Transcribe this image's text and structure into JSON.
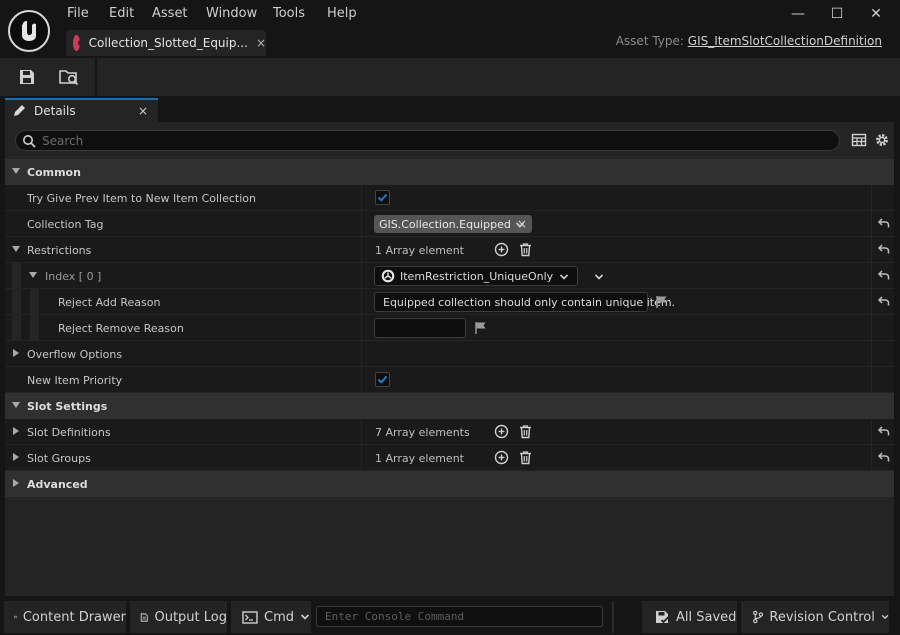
{
  "menu": [
    "File",
    "Edit",
    "Asset",
    "Window",
    "Tools",
    "Help"
  ],
  "document_tab": {
    "label": "Collection_Slotted_Equip...",
    "close": "×"
  },
  "asset_type": {
    "prefix": "Asset Type: ",
    "value": "GIS_ItemSlotCollectionDefinition"
  },
  "window_controls": {
    "minimize": "—",
    "maximize": "☐",
    "close": "✕"
  },
  "details": {
    "tab_label": "Details",
    "tab_close": "×",
    "search_placeholder": "Search",
    "rows": [
      {
        "label": "Common"
      },
      {
        "label": "Try Give Prev Item to New Item Collection",
        "checked": true
      },
      {
        "label": "Collection Tag",
        "tag": "GIS.Collection.Equipped",
        "tag_remove": "×"
      },
      {
        "label": "Restrictions",
        "value": "1 Array element"
      },
      {
        "label": "Index [ 0 ]",
        "value": "ItemRestriction_UniqueOnly"
      },
      {
        "label": "Reject Add Reason",
        "value": "Equipped collection should only contain unique item."
      },
      {
        "label": "Reject Remove Reason",
        "value": ""
      },
      {
        "label": "Overflow Options"
      },
      {
        "label": "New Item Priority",
        "checked": true
      },
      {
        "label": "Slot Settings"
      },
      {
        "label": "Slot Definitions",
        "value": "7 Array elements"
      },
      {
        "label": "Slot Groups",
        "value": "1 Array element"
      },
      {
        "label": "Advanced"
      }
    ]
  },
  "statusbar": {
    "content_drawer": "Content Drawer",
    "output_log": "Output Log",
    "cmd": "Cmd",
    "console_placeholder": "Enter Console Command",
    "all_saved": "All Saved",
    "revision_control": "Revision Control"
  },
  "colors": {
    "accent": "#1c6bb5",
    "asset_icon": "#d03a5a",
    "checkbox": "#2a7fd4"
  }
}
